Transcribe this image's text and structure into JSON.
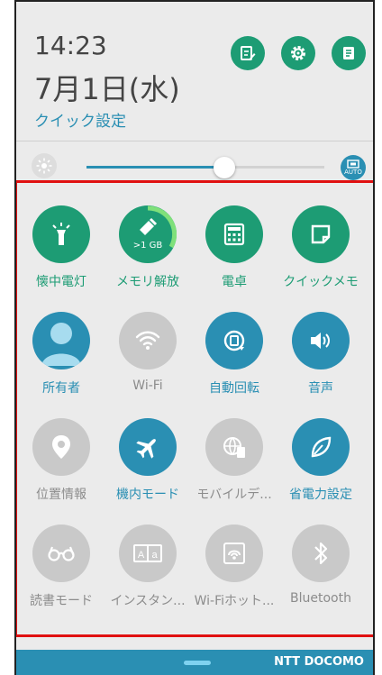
{
  "header": {
    "time": "14:23",
    "date": "7月1日(水)",
    "quick_settings": "クイック設定"
  },
  "brightness": {
    "level_percent": 58,
    "auto_label": "AUTO"
  },
  "tiles": [
    {
      "label": "懐中電灯",
      "icon": "flashlight-icon",
      "state": "on"
    },
    {
      "label": "メモリ解放",
      "icon": "memory-clean-icon",
      "badge": ">1 GB",
      "state": "on"
    },
    {
      "label": "電卓",
      "icon": "calculator-icon",
      "state": "on"
    },
    {
      "label": "クイックメモ",
      "icon": "quick-memo-icon",
      "state": "on"
    },
    {
      "label": "所有者",
      "icon": "owner-avatar-icon",
      "state": "on"
    },
    {
      "label": "Wi-Fi",
      "icon": "wifi-icon",
      "state": "off"
    },
    {
      "label": "自動回転",
      "icon": "auto-rotate-icon",
      "state": "on"
    },
    {
      "label": "音声",
      "icon": "volume-icon",
      "state": "on"
    },
    {
      "label": "位置情報",
      "icon": "location-icon",
      "state": "off"
    },
    {
      "label": "機内モード",
      "icon": "airplane-icon",
      "state": "on"
    },
    {
      "label": "モバイルデ...",
      "icon": "mobile-data-icon",
      "state": "off"
    },
    {
      "label": "省電力設定",
      "icon": "power-saving-icon",
      "state": "on"
    },
    {
      "label": "読書モード",
      "icon": "reading-mode-icon",
      "state": "off"
    },
    {
      "label": "インスタン...",
      "icon": "instant-dictionary-icon",
      "state": "off"
    },
    {
      "label": "Wi-Fiホット...",
      "icon": "wifi-hotspot-icon",
      "state": "off"
    },
    {
      "label": "Bluetooth",
      "icon": "bluetooth-icon",
      "state": "off"
    }
  ],
  "footer": {
    "carrier": "NTT DOCOMO"
  },
  "colors": {
    "green": "#1d9c74",
    "blue": "#2a8fb3",
    "gray": "#c9c9c9",
    "highlight": "#e01010"
  }
}
